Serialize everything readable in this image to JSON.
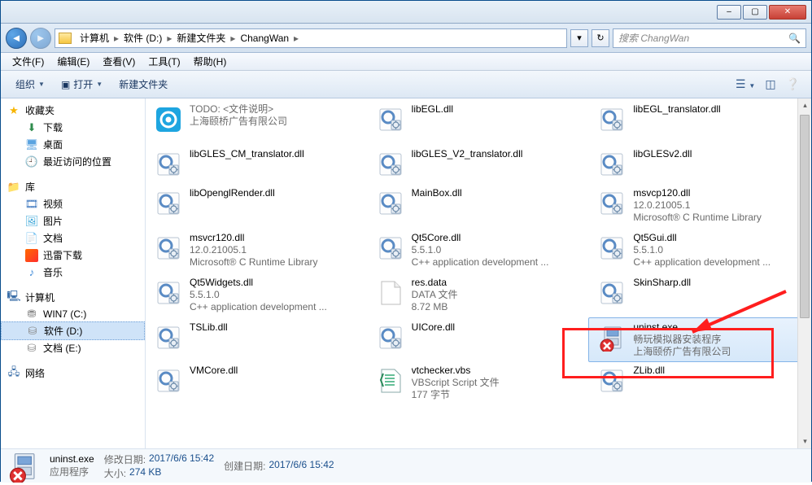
{
  "titlebar": {
    "min": "–",
    "max": "▢",
    "close": "✕"
  },
  "address": {
    "crumbs": [
      "计算机",
      "软件 (D:)",
      "新建文件夹",
      "ChangWan"
    ],
    "search_placeholder": "搜索 ChangWan"
  },
  "menu": [
    "文件(F)",
    "编辑(E)",
    "查看(V)",
    "工具(T)",
    "帮助(H)"
  ],
  "toolbar": {
    "organize": "组织",
    "open": "打开",
    "newfolder": "新建文件夹"
  },
  "nav": {
    "fav": "收藏夹",
    "fav_items": [
      "下载",
      "桌面",
      "最近访问的位置"
    ],
    "lib": "库",
    "lib_items": [
      "视频",
      "图片",
      "文档",
      "迅雷下载",
      "音乐"
    ],
    "comp": "计算机",
    "comp_items": [
      "WIN7 (C:)",
      "软件 (D:)",
      "文档 (E:)"
    ],
    "net": "网络"
  },
  "files": [
    {
      "name": "",
      "meta1": "TODO: <文件说明>",
      "meta2": "上海颐桥广告有限公司",
      "ico": "launcher"
    },
    {
      "name": "libEGL.dll",
      "ico": "dll"
    },
    {
      "name": "libEGL_translator.dll",
      "ico": "dll"
    },
    {
      "name": "libGLES_CM_translator.dll",
      "ico": "dll"
    },
    {
      "name": "libGLES_V2_translator.dll",
      "ico": "dll"
    },
    {
      "name": "libGLESv2.dll",
      "ico": "dll"
    },
    {
      "name": "libOpenglRender.dll",
      "ico": "dll"
    },
    {
      "name": "MainBox.dll",
      "ico": "dll"
    },
    {
      "name": "msvcp120.dll",
      "meta1": "12.0.21005.1",
      "meta2": "Microsoft® C Runtime Library",
      "ico": "dll"
    },
    {
      "name": "msvcr120.dll",
      "meta1": "12.0.21005.1",
      "meta2": "Microsoft® C Runtime Library",
      "ico": "dll"
    },
    {
      "name": "Qt5Core.dll",
      "meta1": "5.5.1.0",
      "meta2": "C++ application development ...",
      "ico": "dll"
    },
    {
      "name": "Qt5Gui.dll",
      "meta1": "5.5.1.0",
      "meta2": "C++ application development ...",
      "ico": "dll"
    },
    {
      "name": "Qt5Widgets.dll",
      "meta1": "5.5.1.0",
      "meta2": "C++ application development ...",
      "ico": "dll"
    },
    {
      "name": "res.data",
      "meta1": "DATA 文件",
      "meta2": "8.72 MB",
      "ico": "file"
    },
    {
      "name": "SkinSharp.dll",
      "ico": "dll"
    },
    {
      "name": "TSLib.dll",
      "ico": "dll"
    },
    {
      "name": "UICore.dll",
      "ico": "dll"
    },
    {
      "name": "uninst.exe",
      "meta1": "畅玩模拟器安装程序",
      "meta2": "上海颐侨广告有限公司",
      "ico": "uninst",
      "highlight": true
    },
    {
      "name": "VMCore.dll",
      "ico": "dll"
    },
    {
      "name": "vtchecker.vbs",
      "meta1": "VBScript Script 文件",
      "meta2": "177 字节",
      "ico": "vbs"
    },
    {
      "name": "ZLib.dll",
      "ico": "dll"
    }
  ],
  "details": {
    "name": "uninst.exe",
    "type": "应用程序",
    "mod_label": "修改日期:",
    "mod_val": "2017/6/6 15:42",
    "size_label": "大小:",
    "size_val": "274 KB",
    "created_label": "创建日期:",
    "created_val": "2017/6/6 15:42"
  }
}
